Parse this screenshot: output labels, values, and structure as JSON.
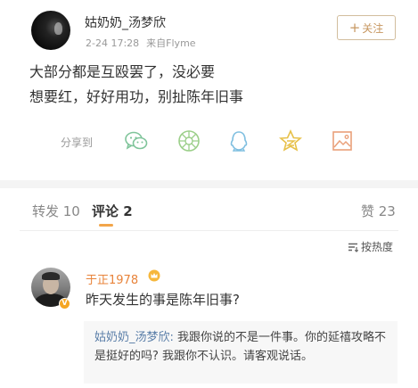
{
  "post": {
    "author": "姑奶奶_汤梦欣",
    "time": "2-24 17:28",
    "source": "来自Flyme",
    "follow_label": "关注",
    "lines": [
      "大部分都是互殴罢了，没必要",
      "想要红，好好用功，别扯陈年旧事"
    ]
  },
  "share": {
    "label": "分享到",
    "targets": [
      "wechat-icon",
      "moments-icon",
      "qq-icon",
      "qzone-icon",
      "image-icon"
    ]
  },
  "tabs": {
    "repost": "转发 10",
    "comment": "评论 2",
    "like": "赞 23"
  },
  "sort": {
    "label": "按热度"
  },
  "comment": {
    "author": "于正1978",
    "text": "昨天发生的事是陈年旧事?",
    "reply_author": "姑奶奶_汤梦欣:",
    "reply_text": "我跟你说的不是一件事。你的延禧攻略不是挺好的吗? 我跟你不认识。请客观说话。"
  },
  "colors": {
    "accent_gold": "#c79760",
    "tab_underline": "#f2a54a",
    "commenter_orange": "#e8833a",
    "reply_author_blue": "#5a7ea8"
  }
}
